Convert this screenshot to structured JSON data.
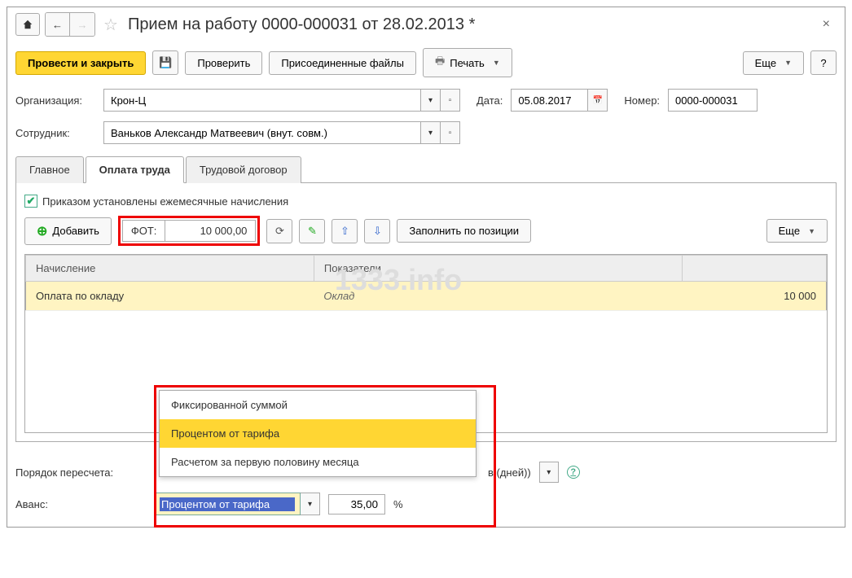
{
  "title": "Прием на работу 0000-000031 от 28.02.2013 *",
  "toolbar": {
    "main_btn": "Провести и закрыть",
    "check": "Проверить",
    "attached": "Присоединенные файлы",
    "print": "Печать",
    "more": "Еще",
    "help": "?"
  },
  "form": {
    "org_label": "Организация:",
    "org_value": "Крон-Ц",
    "date_label": "Дата:",
    "date_value": "05.08.2017",
    "number_label": "Номер:",
    "number_value": "0000-000031",
    "employee_label": "Сотрудник:",
    "employee_value": "Ваньков Александр Матвеевич (внут. совм.)"
  },
  "tabs": {
    "main": "Главное",
    "payment": "Оплата труда",
    "contract": "Трудовой договор"
  },
  "content": {
    "checkbox_label": "Приказом установлены ежемесячные начисления",
    "add_btn": "Добавить",
    "fot_label": "ФОТ:",
    "fot_value": "10 000,00",
    "fill_btn": "Заполнить по позиции",
    "more_btn": "Еще",
    "col_accrual": "Начисление",
    "col_indicators": "Показатели",
    "row_accrual": "Оплата по окладу",
    "row_indicator": "Оклад",
    "row_value": "10 000"
  },
  "dropdown": {
    "item1": "Фиксированной суммой",
    "item2": "Процентом от тарифа",
    "item3": "Расчетом за первую половину месяца"
  },
  "bottom": {
    "recalc_label": "Порядок пересчета:",
    "recalc_suffix": "в (дней))",
    "advance_label": "Аванс:",
    "advance_value": "Процентом от тарифа",
    "pct_value": "35,00",
    "pct_sign": "%"
  },
  "watermark": "1333.info"
}
